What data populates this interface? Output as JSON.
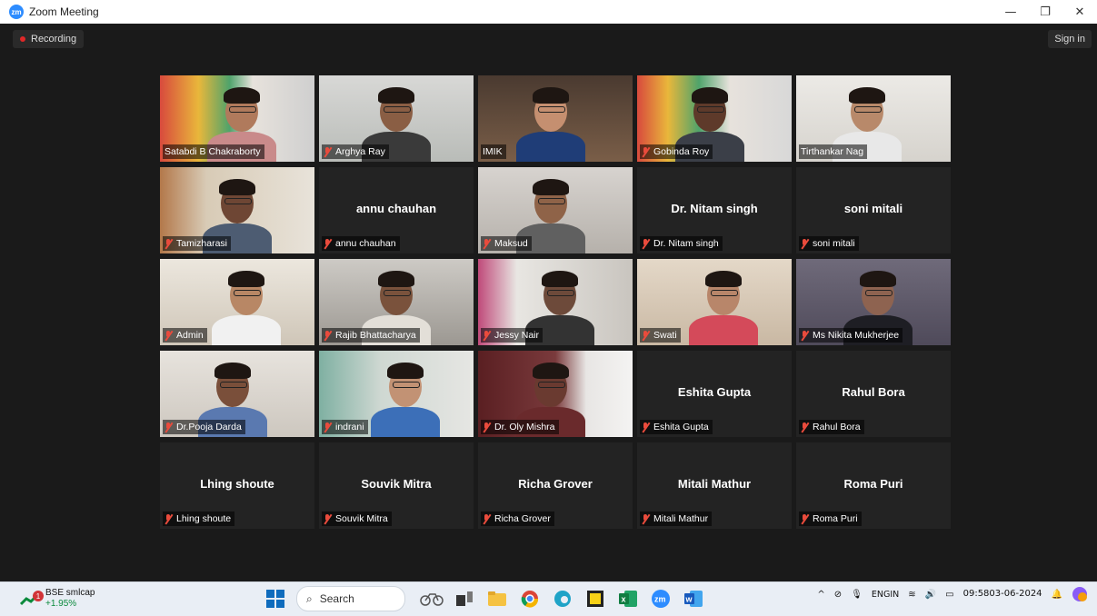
{
  "window": {
    "title": "Zoom Meeting",
    "app_logo": "zm"
  },
  "meeting": {
    "recording_label": "Recording",
    "sign_in_label": "Sign in"
  },
  "participants": [
    {
      "name": "Satabdi B Chakraborty",
      "muted": false,
      "video": true,
      "active": true
    },
    {
      "name": "Arghya Ray",
      "muted": true,
      "video": true
    },
    {
      "name": "IMIK",
      "muted": false,
      "video": true
    },
    {
      "name": "Gobinda Roy",
      "muted": true,
      "video": true
    },
    {
      "name": "Tirthankar Nag",
      "muted": false,
      "video": true
    },
    {
      "name": "Tamizharasi",
      "muted": true,
      "video": true
    },
    {
      "name": "annu chauhan",
      "muted": true,
      "video": false
    },
    {
      "name": "Maksud",
      "muted": true,
      "video": true
    },
    {
      "name": "Dr. Nitam singh",
      "muted": true,
      "video": false
    },
    {
      "name": "soni mitali",
      "muted": true,
      "video": false
    },
    {
      "name": "Admin",
      "muted": true,
      "video": true
    },
    {
      "name": "Rajib Bhattacharya",
      "muted": true,
      "video": true
    },
    {
      "name": "Jessy Nair",
      "muted": true,
      "video": true
    },
    {
      "name": "Swati",
      "muted": true,
      "video": true
    },
    {
      "name": "Ms Nikita Mukherjee",
      "muted": true,
      "video": true
    },
    {
      "name": "Dr.Pooja Darda",
      "muted": true,
      "video": true
    },
    {
      "name": "indrani",
      "muted": true,
      "video": true
    },
    {
      "name": "Dr. Oly Mishra",
      "muted": true,
      "video": true
    },
    {
      "name": "Eshita Gupta",
      "muted": true,
      "video": false
    },
    {
      "name": "Rahul Bora",
      "muted": true,
      "video": false
    },
    {
      "name": "Lhing shoute",
      "muted": true,
      "video": false
    },
    {
      "name": "Souvik Mitra",
      "muted": true,
      "video": false
    },
    {
      "name": "Richa Grover",
      "muted": true,
      "video": false
    },
    {
      "name": "Mitali Mathur",
      "muted": true,
      "video": false
    },
    {
      "name": "Roma Puri",
      "muted": true,
      "video": false
    }
  ],
  "taskbar": {
    "stock_name": "BSE smlcap",
    "stock_change": "+1.95%",
    "stock_badge": "1",
    "search_placeholder": "Search",
    "lang_top": "ENG",
    "lang_bottom": "IN",
    "time": "09:58",
    "date": "03-06-2024"
  },
  "colors": {
    "active_speaker": "#b9e34a",
    "muted_icon": "#e94b3c",
    "zoom_blue": "#2d8cff"
  }
}
